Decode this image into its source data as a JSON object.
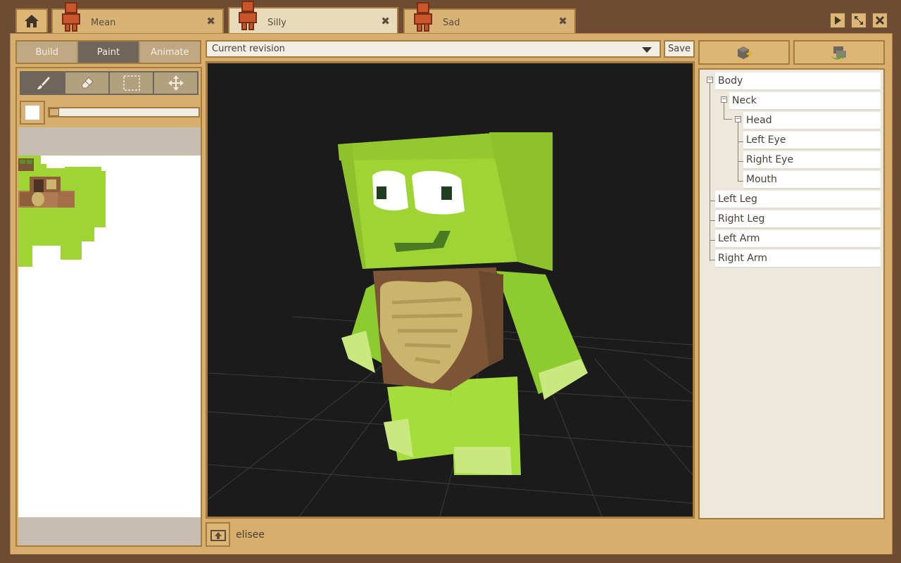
{
  "tabs": [
    {
      "label": "Mean",
      "active": false
    },
    {
      "label": "Silly",
      "active": true
    },
    {
      "label": "Sad",
      "active": false
    }
  ],
  "tab_close_glyph": "✖",
  "modes": {
    "build": "Build",
    "paint": "Paint",
    "animate": "Animate",
    "selected": "Paint"
  },
  "tools": [
    "brush-icon",
    "eraser-icon",
    "select-rect-icon",
    "move-icon"
  ],
  "paint": {
    "current_color": "#ffffff"
  },
  "revision": {
    "selected": "Current revision"
  },
  "save_label": "Save",
  "user": "elisee",
  "tree": [
    {
      "label": "Body",
      "depth": 0,
      "expanded": true
    },
    {
      "label": "Neck",
      "depth": 1,
      "expanded": true
    },
    {
      "label": "Head",
      "depth": 2,
      "expanded": true
    },
    {
      "label": "Left Eye",
      "depth": 3
    },
    {
      "label": "Right Eye",
      "depth": 3
    },
    {
      "label": "Mouth",
      "depth": 3
    },
    {
      "label": "Left Leg",
      "depth": 1
    },
    {
      "label": "Right Leg",
      "depth": 1
    },
    {
      "label": "Left Arm",
      "depth": 1
    },
    {
      "label": "Right Arm",
      "depth": 1
    }
  ],
  "colors": {
    "accent": "#d7ae6c",
    "frame_border": "#a57b3e",
    "viewport_bg": "#1b1b1b",
    "model_green": "#9ed433",
    "shell_brown": "#7b5535",
    "shell_tan": "#cbb56c"
  }
}
